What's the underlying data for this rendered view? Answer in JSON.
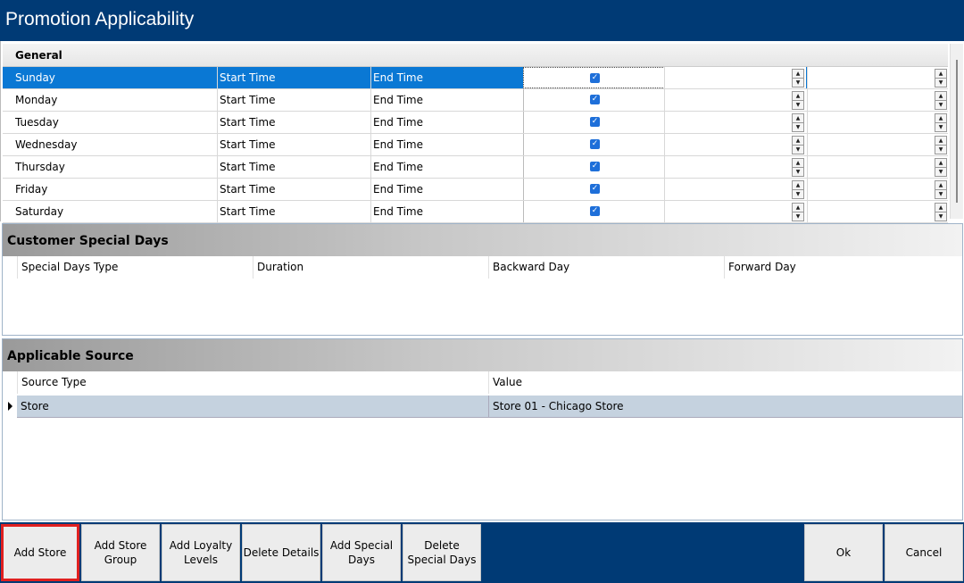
{
  "window": {
    "title": "Promotion Applicability"
  },
  "general": {
    "header": "General",
    "rows": [
      {
        "day": "Sunday",
        "start": "Start Time",
        "end": "End Time",
        "checked": true,
        "selected": true
      },
      {
        "day": "Monday",
        "start": "Start Time",
        "end": "End Time",
        "checked": true,
        "selected": false
      },
      {
        "day": "Tuesday",
        "start": "Start Time",
        "end": "End Time",
        "checked": true,
        "selected": false
      },
      {
        "day": "Wednesday",
        "start": "Start Time",
        "end": "End Time",
        "checked": true,
        "selected": false
      },
      {
        "day": "Thursday",
        "start": "Start Time",
        "end": "End Time",
        "checked": true,
        "selected": false
      },
      {
        "day": "Friday",
        "start": "Start Time",
        "end": "End Time",
        "checked": true,
        "selected": false
      },
      {
        "day": "Saturday",
        "start": "Start Time",
        "end": "End Time",
        "checked": true,
        "selected": false
      }
    ]
  },
  "special_days": {
    "title": "Customer Special Days",
    "columns": [
      "Special Days Type",
      "Duration",
      "Backward Day",
      "Forward Day"
    ]
  },
  "source": {
    "title": "Applicable Source",
    "columns": [
      "Source Type",
      "Value"
    ],
    "rows": [
      {
        "type": "Store",
        "value": "Store 01 - Chicago Store"
      }
    ]
  },
  "footer": {
    "buttons": {
      "add_store": "Add Store",
      "add_store_group": "Add Store\nGroup",
      "add_loyalty_levels": "Add Loyalty\nLevels",
      "delete_details": "Delete Details",
      "add_special_days": "Add Special\nDays",
      "delete_special_days": "Delete\nSpecial Days",
      "ok": "Ok",
      "cancel": "Cancel"
    }
  },
  "colors": {
    "titlebar": "#003a75",
    "selection": "#0a78d4",
    "highlight": "#e02020"
  }
}
